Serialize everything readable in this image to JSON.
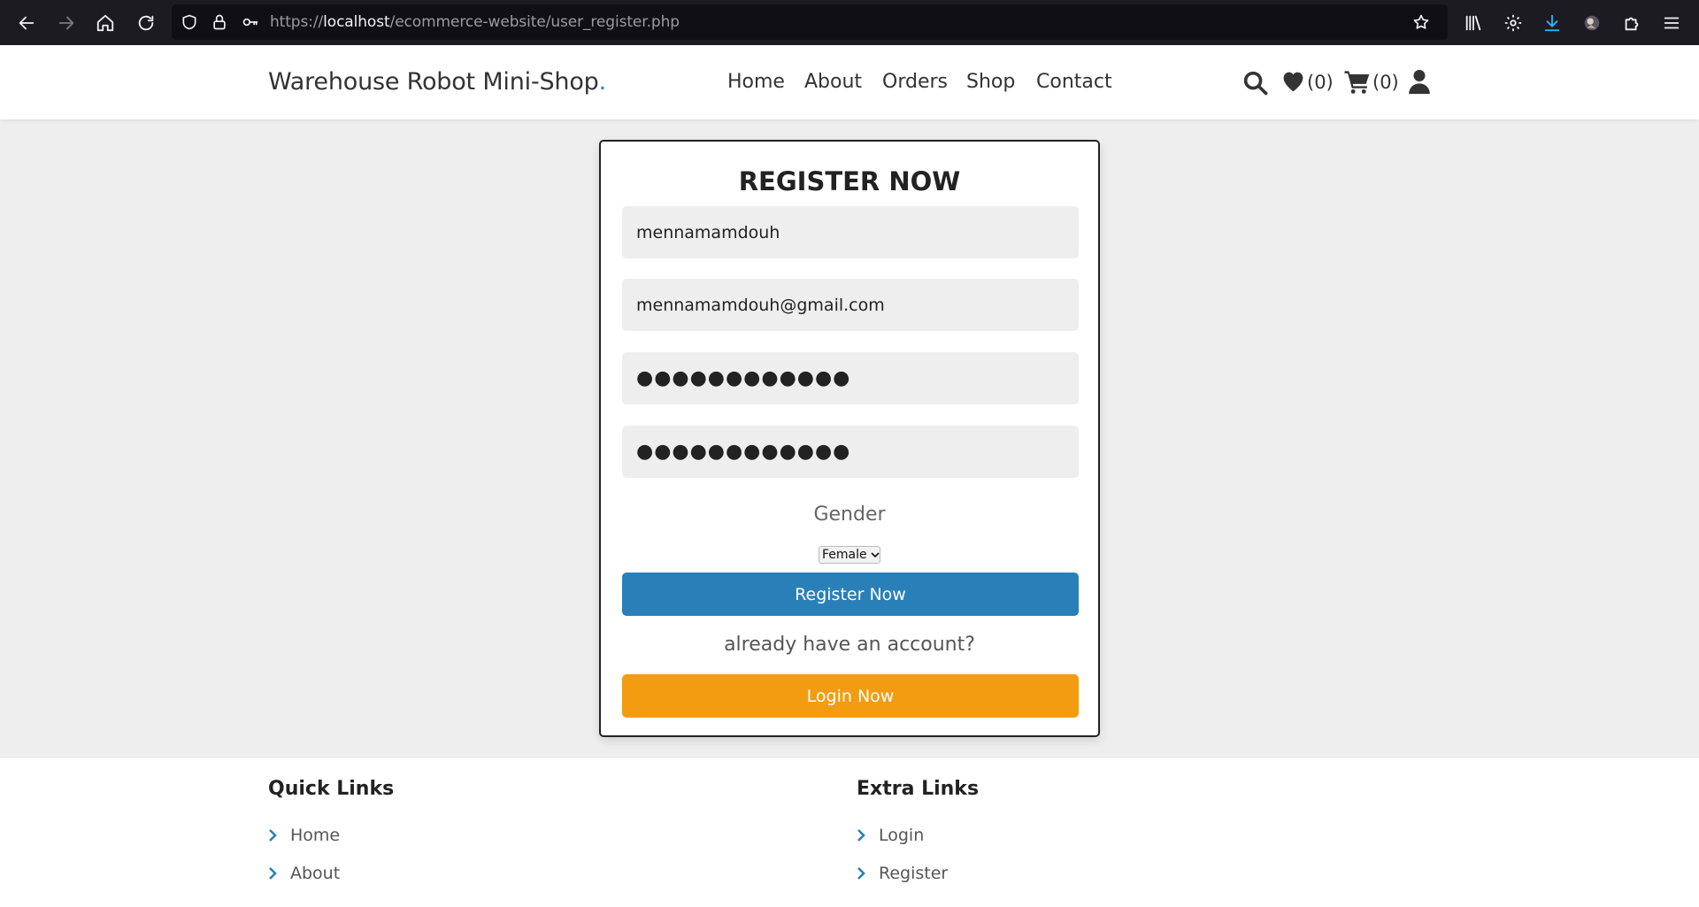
{
  "browser": {
    "url_scheme": "https://",
    "url_host": "localhost",
    "url_path": "/ecommerce-website/user_register.php"
  },
  "header": {
    "logo_text": "Warehouse Robot Mini-Shop",
    "logo_dot": ".",
    "nav": [
      "Home",
      "About",
      "Orders",
      "Shop",
      "Contact"
    ],
    "wishlist_count": "(0)",
    "cart_count": "(0)"
  },
  "form": {
    "title": "Register Now",
    "name_value": "mennamamdouh",
    "email_value": "mennamamdouh@gmail.com",
    "password_mask": "●●●●●●●●●●●●",
    "confirm_password_mask": "●●●●●●●●●●●●",
    "gender_label": "Gender",
    "gender_selected": "Female",
    "register_button": "Register Now",
    "already_text": "already have an account?",
    "login_button": "Login Now"
  },
  "footer": {
    "quick_links_heading": "Quick Links",
    "quick_links": [
      "Home",
      "About"
    ],
    "extra_links_heading": "Extra Links",
    "extra_links": [
      "Login",
      "Register"
    ]
  },
  "colors": {
    "accent_blue": "#2980b9",
    "accent_orange": "#f39c12",
    "background": "#eeeeee",
    "browser_chrome": "#1c1b22"
  },
  "icons": {
    "browser": [
      "back-arrow-icon",
      "forward-arrow-icon",
      "home-icon",
      "reload-icon",
      "shield-icon",
      "lock-icon",
      "key-icon",
      "star-icon",
      "library-icon",
      "settings-gear-icon",
      "download-icon",
      "extension-avatar-icon",
      "puzzle-icon",
      "hamburger-menu-icon"
    ],
    "header": [
      "search-icon",
      "heart-icon",
      "cart-icon",
      "user-icon"
    ],
    "footer": [
      "chevron-right-icon"
    ]
  }
}
